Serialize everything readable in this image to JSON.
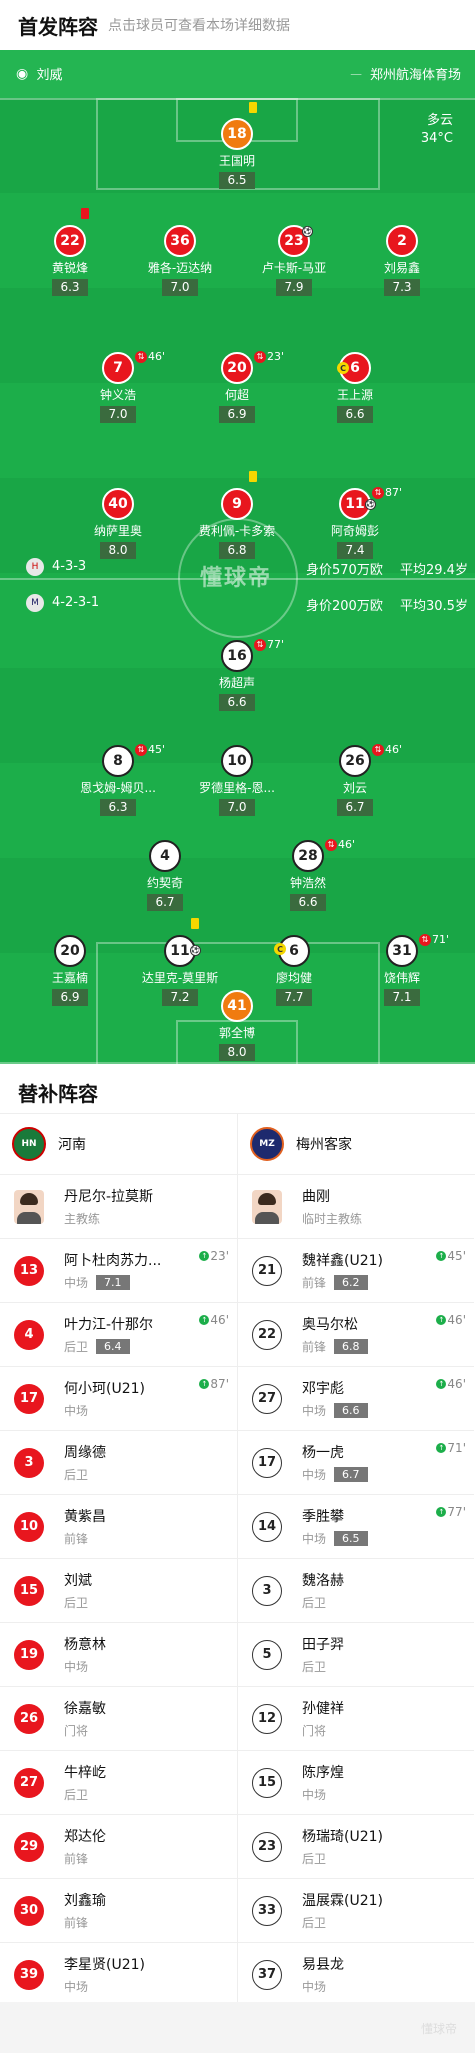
{
  "header": {
    "title": "首发阵容",
    "subtitle": "点击球员可查看本场详细数据"
  },
  "match": {
    "referee": "刘威",
    "venue": "郑州航海体育场",
    "weather": "多云",
    "temperature": "34°C"
  },
  "colors": {
    "pitch": "#1cae4a",
    "home": "#e8161e",
    "away_kit": "#ffffff",
    "gk_home": "#f07b10",
    "gk_away": "#f07b10"
  },
  "home_team": {
    "formation": "4-3-3",
    "value_label": "身价570万欧",
    "avg_age": "平均29.4岁"
  },
  "away_team": {
    "formation": "4-2-3-1",
    "value_label": "身价200万欧",
    "avg_age": "平均30.5岁"
  },
  "watermark": "懂球帝",
  "home_players": [
    {
      "num": "18",
      "name": "王国明",
      "rating": "6.5"
    },
    {
      "num": "22",
      "name": "黄锐烽",
      "rating": "6.3"
    },
    {
      "num": "36",
      "name": "雅各-迈达纳",
      "rating": "7.0"
    },
    {
      "num": "23",
      "name": "卢卡斯-马亚",
      "rating": "7.9"
    },
    {
      "num": "2",
      "name": "刘易鑫",
      "rating": "7.3"
    },
    {
      "num": "7",
      "name": "钟义浩",
      "rating": "7.0",
      "sub": "46'"
    },
    {
      "num": "20",
      "name": "何超",
      "rating": "6.9",
      "sub": "23'"
    },
    {
      "num": "6",
      "name": "王上源",
      "rating": "6.6"
    },
    {
      "num": "40",
      "name": "纳萨里奥",
      "rating": "8.0"
    },
    {
      "num": "9",
      "name": "费利佩-卡多索",
      "rating": "6.8"
    },
    {
      "num": "11",
      "name": "阿奇姆彭",
      "rating": "7.4",
      "sub": "87'"
    }
  ],
  "away_players": [
    {
      "num": "16",
      "name": "杨超声",
      "rating": "6.6",
      "sub": "77'"
    },
    {
      "num": "8",
      "name": "恩戈姆-姆贝...",
      "rating": "6.3",
      "sub": "45'"
    },
    {
      "num": "10",
      "name": "罗德里格-恩...",
      "rating": "7.0"
    },
    {
      "num": "26",
      "name": "刘云",
      "rating": "6.7",
      "sub": "46'"
    },
    {
      "num": "4",
      "name": "约契奇",
      "rating": "6.7"
    },
    {
      "num": "28",
      "name": "钟浩然",
      "rating": "6.6",
      "sub": "46'"
    },
    {
      "num": "20",
      "name": "王嘉楠",
      "rating": "6.9"
    },
    {
      "num": "11",
      "name": "达里克-莫里斯",
      "rating": "7.2"
    },
    {
      "num": "6",
      "name": "廖均健",
      "rating": "7.7"
    },
    {
      "num": "31",
      "name": "饶伟辉",
      "rating": "7.1",
      "sub": "71'"
    },
    {
      "num": "41",
      "name": "郭全博",
      "rating": "8.0"
    }
  ],
  "subs": {
    "title": "替补阵容",
    "home": {
      "team": "河南",
      "coach": {
        "name": "丹尼尔-拉莫斯",
        "role": "主教练"
      },
      "players": [
        {
          "num": "13",
          "name": "阿卜杜肉苏力...",
          "pos": "中场",
          "rating": "7.1",
          "time": "23'"
        },
        {
          "num": "4",
          "name": "叶力江-什那尔",
          "pos": "后卫",
          "rating": "6.4",
          "time": "46'"
        },
        {
          "num": "17",
          "name": "何小珂(U21)",
          "pos": "中场",
          "time": "87'"
        },
        {
          "num": "3",
          "name": "周缘德",
          "pos": "后卫"
        },
        {
          "num": "10",
          "name": "黄紫昌",
          "pos": "前锋"
        },
        {
          "num": "15",
          "name": "刘斌",
          "pos": "后卫"
        },
        {
          "num": "19",
          "name": "杨意林",
          "pos": "中场"
        },
        {
          "num": "26",
          "name": "徐嘉敏",
          "pos": "门将"
        },
        {
          "num": "27",
          "name": "牛梓屹",
          "pos": "后卫"
        },
        {
          "num": "29",
          "name": "郑达伦",
          "pos": "前锋"
        },
        {
          "num": "30",
          "name": "刘鑫瑜",
          "pos": "前锋"
        },
        {
          "num": "39",
          "name": "李星贤(U21)",
          "pos": "中场"
        }
      ]
    },
    "away": {
      "team": "梅州客家",
      "coach": {
        "name": "曲刚",
        "role": "临时主教练"
      },
      "players": [
        {
          "num": "21",
          "name": "魏祥鑫(U21)",
          "pos": "前锋",
          "rating": "6.2",
          "time": "45'"
        },
        {
          "num": "22",
          "name": "奥马尔松",
          "pos": "前锋",
          "rating": "6.8",
          "time": "46'"
        },
        {
          "num": "27",
          "name": "邓宇彪",
          "pos": "中场",
          "rating": "6.6",
          "time": "46'"
        },
        {
          "num": "17",
          "name": "杨一虎",
          "pos": "中场",
          "rating": "6.7",
          "time": "71'"
        },
        {
          "num": "14",
          "name": "季胜攀",
          "pos": "中场",
          "rating": "6.5",
          "time": "77'"
        },
        {
          "num": "3",
          "name": "魏洛赫",
          "pos": "后卫"
        },
        {
          "num": "5",
          "name": "田子羿",
          "pos": "后卫"
        },
        {
          "num": "12",
          "name": "孙健祥",
          "pos": "门将"
        },
        {
          "num": "15",
          "name": "陈序煌",
          "pos": "中场"
        },
        {
          "num": "23",
          "name": "杨瑞琦(U21)",
          "pos": "后卫"
        },
        {
          "num": "33",
          "name": "温展霖(U21)",
          "pos": "后卫"
        },
        {
          "num": "37",
          "name": "易县龙",
          "pos": "中场"
        }
      ]
    }
  }
}
